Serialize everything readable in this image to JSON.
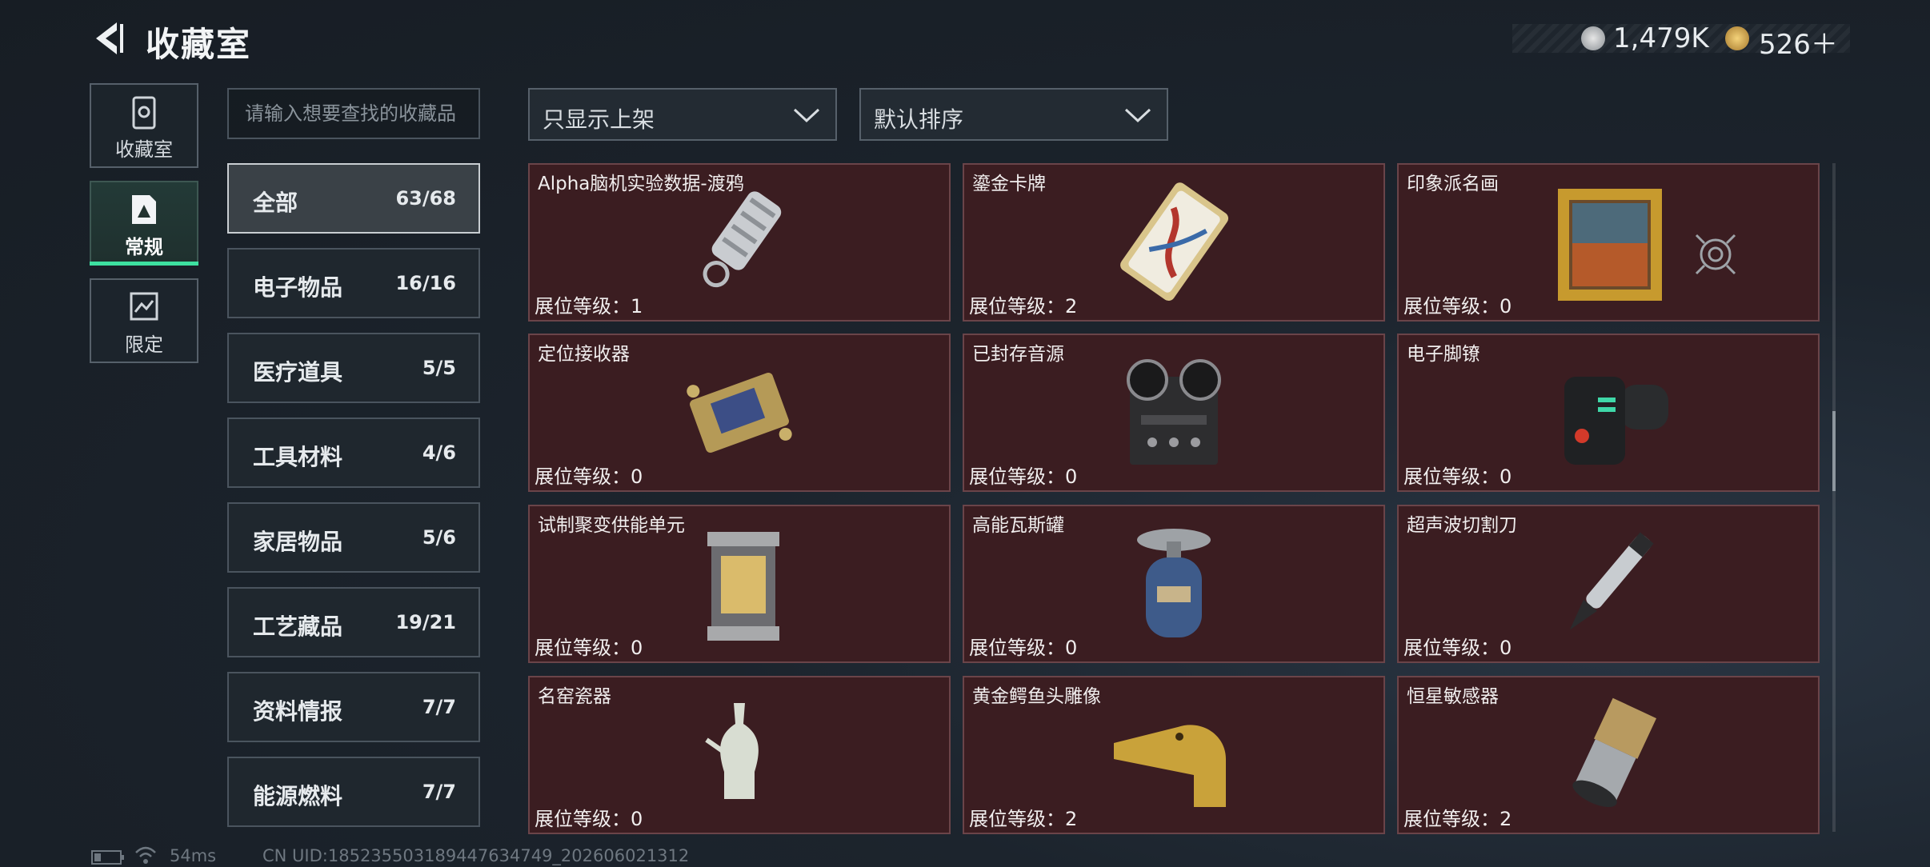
{
  "header": {
    "title": "收藏室"
  },
  "currency": [
    {
      "icon": "silver-coin-icon",
      "value": "1,479K"
    },
    {
      "icon": "gold-coin-icon",
      "value": "526＋"
    }
  ],
  "nav_tabs": [
    {
      "label": "收藏室",
      "icon": "collection-box-icon"
    },
    {
      "label": "常规",
      "icon": "regular-card-icon",
      "active": true
    },
    {
      "label": "限定",
      "icon": "limited-card-icon"
    }
  ],
  "search": {
    "placeholder": "请输入想要查找的收藏品"
  },
  "categories": [
    {
      "name": "全部",
      "count": "63/68",
      "active": true
    },
    {
      "name": "电子物品",
      "count": "16/16"
    },
    {
      "name": "医疗道具",
      "count": "5/5"
    },
    {
      "name": "工具材料",
      "count": "4/6"
    },
    {
      "name": "家居物品",
      "count": "5/6"
    },
    {
      "name": "工艺藏品",
      "count": "19/21"
    },
    {
      "name": "资料情报",
      "count": "7/7"
    },
    {
      "name": "能源燃料",
      "count": "7/7"
    }
  ],
  "filters": {
    "display": "只显示上架",
    "sort": "默认排序"
  },
  "items": [
    {
      "name": "Alpha脑机实验数据-渡鸦",
      "level": "展位等级：1",
      "icon": "usb-drive-icon"
    },
    {
      "name": "鎏金卡牌",
      "level": "展位等级：2",
      "icon": "gilded-card-icon"
    },
    {
      "name": "印象派名画",
      "level": "展位等级：0",
      "icon": "framed-painting-icon"
    },
    {
      "name": "定位接收器",
      "level": "展位等级：0",
      "icon": "locator-receiver-icon"
    },
    {
      "name": "已封存音源",
      "level": "展位等级：0",
      "icon": "reel-recorder-icon"
    },
    {
      "name": "电子脚镣",
      "level": "展位等级：0",
      "icon": "ankle-monitor-icon"
    },
    {
      "name": "试制聚变供能单元",
      "level": "展位等级：0",
      "icon": "fusion-cell-icon"
    },
    {
      "name": "高能瓦斯罐",
      "level": "展位等级：0",
      "icon": "gas-canister-icon"
    },
    {
      "name": "超声波切割刀",
      "level": "展位等级：0",
      "icon": "ultrasonic-cutter-icon"
    },
    {
      "name": "名窑瓷器",
      "level": "展位等级：0",
      "icon": "porcelain-vase-icon"
    },
    {
      "name": "黄金鳄鱼头雕像",
      "level": "展位等级：2",
      "icon": "gold-crocodile-icon"
    },
    {
      "name": "恒星敏感器",
      "level": "展位等级：2",
      "icon": "star-sensor-icon"
    }
  ],
  "status_bar": {
    "ping": "54ms",
    "uid": "CN UID:18523550318944763474​9_202606021312"
  },
  "colors": {
    "card_bg": "#3b1d21",
    "accent": "#3de0a0"
  }
}
